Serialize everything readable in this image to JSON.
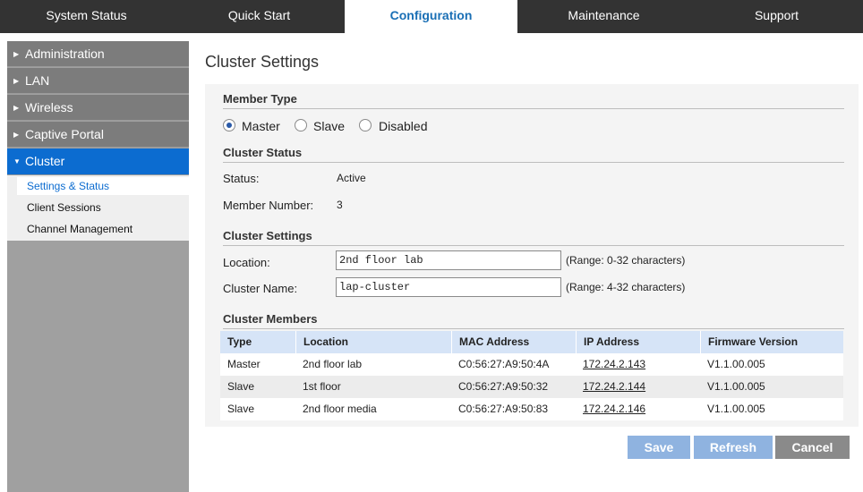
{
  "topnav": {
    "tabs": [
      {
        "label": "System Status"
      },
      {
        "label": "Quick Start"
      },
      {
        "label": "Configuration"
      },
      {
        "label": "Maintenance"
      },
      {
        "label": "Support"
      }
    ],
    "active_tab": "Configuration"
  },
  "sidebar": {
    "items": [
      {
        "label": "Administration"
      },
      {
        "label": "LAN"
      },
      {
        "label": "Wireless"
      },
      {
        "label": "Captive Portal"
      },
      {
        "label": "Cluster"
      }
    ],
    "active_item": "Cluster",
    "subitems": [
      {
        "label": "Settings & Status"
      },
      {
        "label": "Client Sessions"
      },
      {
        "label": "Channel Management"
      }
    ],
    "active_subitem": "Settings & Status"
  },
  "main": {
    "title": "Cluster Settings",
    "member_type": {
      "heading": "Member Type",
      "options": [
        "Master",
        "Slave",
        "Disabled"
      ],
      "selected": "Master"
    },
    "cluster_status": {
      "heading": "Cluster Status",
      "status_label": "Status:",
      "status_value": "Active",
      "member_number_label": "Member Number:",
      "member_number_value": "3"
    },
    "cluster_settings": {
      "heading": "Cluster Settings",
      "location_label": "Location:",
      "location_value": "2nd floor lab",
      "location_range": "(Range: 0-32 characters)",
      "name_label": "Cluster Name:",
      "name_value": "lap-cluster",
      "name_range": "(Range: 4-32 characters)"
    },
    "cluster_members": {
      "heading": "Cluster Members",
      "columns": [
        "Type",
        "Location",
        "MAC Address",
        "IP Address",
        "Firmware Version"
      ],
      "rows": [
        [
          "Master",
          "2nd floor lab",
          "C0:56:27:A9:50:4A",
          "172.24.2.143",
          "V1.1.00.005"
        ],
        [
          "Slave",
          "1st floor",
          "C0:56:27:A9:50:32",
          "172.24.2.144",
          "V1.1.00.005"
        ],
        [
          "Slave",
          "2nd floor media",
          "C0:56:27:A9:50:83",
          "172.24.2.146",
          "V1.1.00.005"
        ]
      ]
    },
    "buttons": {
      "save": "Save",
      "refresh": "Refresh",
      "cancel": "Cancel"
    }
  },
  "colors": {
    "topnav_bg": "#333333",
    "active_tab_text": "#1a6fb5",
    "sidebar_item_bg": "#7c7c7c",
    "sidebar_active_bg": "#0c6cd0",
    "table_header_bg": "#d6e4f7",
    "button_blue": "#8fb3e0",
    "button_gray": "#8a8a8a"
  },
  "icons": {
    "collapsed_arrow": "triangle-right-icon",
    "expanded_arrow": "triangle-down-icon"
  }
}
